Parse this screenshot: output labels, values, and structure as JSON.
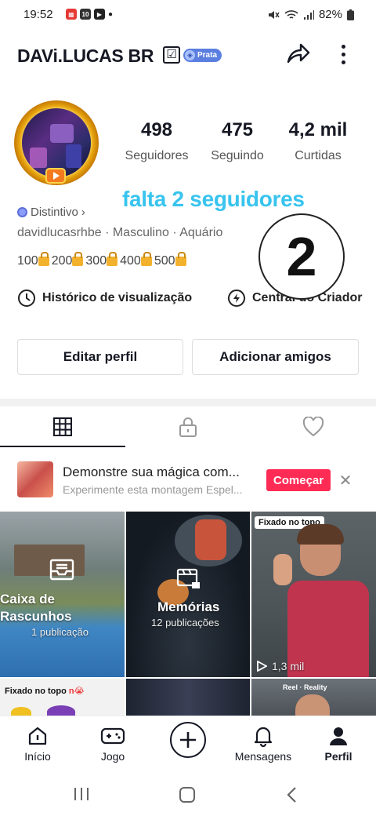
{
  "status_bar": {
    "time": "19:52",
    "battery": "82%"
  },
  "profile": {
    "username": "DAVi.LUCAS BR",
    "verified_mark": "☑",
    "rank_label": "Prata",
    "stats": [
      {
        "value": "498",
        "label": "Seguidores"
      },
      {
        "value": "475",
        "label": "Seguindo"
      },
      {
        "value": "4,2 mil",
        "label": "Curtidas"
      }
    ],
    "overlay_message": "falta 2 seguidores",
    "badge_link": "Distintivo",
    "bio": "davidlucasrhbe · Masculino · Aquário",
    "milestones": [
      "100",
      "200",
      "300",
      "400",
      "500"
    ],
    "overlay_number": "2",
    "history_link": "Histórico de visualização",
    "creator_center": "Central do Criador",
    "edit_button": "Editar perfil",
    "add_friends_button": "Adicionar amigos"
  },
  "tabs": [
    "grid-icon",
    "lock-icon",
    "heart-icon"
  ],
  "promo": {
    "title": "Demonstre sua mágica com...",
    "subtitle": "Experimente esta montagem Espel...",
    "button": "Começar"
  },
  "grid": {
    "drafts_title_1": "Caixa de",
    "drafts_title_2": "Rascunhos",
    "drafts_count": "1 publicação",
    "memories_title": "Memórias",
    "memories_count": "12 publicações",
    "pinned_tag": "Fixado no topo",
    "pinned_views": "1,3 mil",
    "pinned_tag_2": "Fixado no topo"
  },
  "bottom_nav": [
    {
      "label": "Início",
      "icon": "home-icon"
    },
    {
      "label": "Jogo",
      "icon": "gamepad-icon"
    },
    {
      "label": "",
      "icon": "plus-icon"
    },
    {
      "label": "Mensagens",
      "icon": "bell-icon"
    },
    {
      "label": "Perfil",
      "icon": "person-icon"
    }
  ]
}
